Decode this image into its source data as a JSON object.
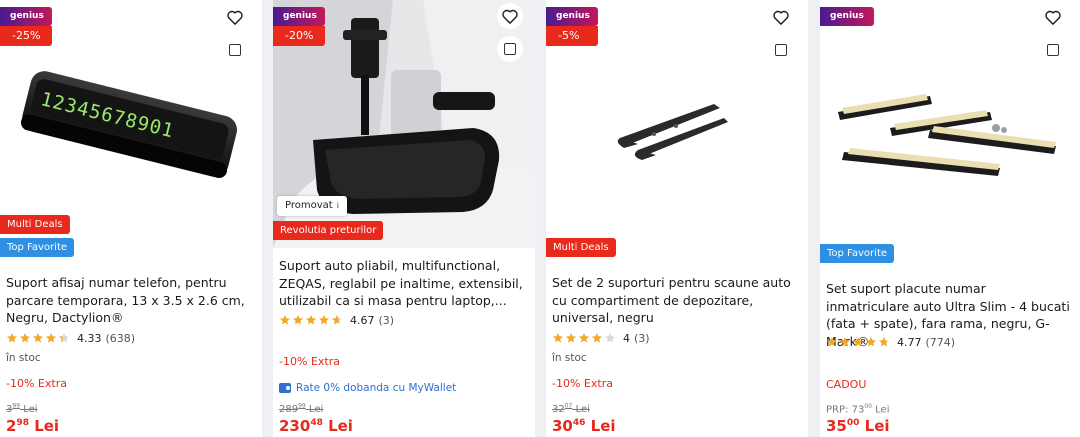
{
  "products": [
    {
      "genius": "genius",
      "discount": "-25%",
      "badges": [
        "Multi Deals",
        "Top Favorite"
      ],
      "title": "Suport afisaj numar telefon, pentru parcare temporara, 13 x 3.5 x 2.6 cm, Negru, Dactylion®",
      "rating": "4.33",
      "reviews": "(638)",
      "stars": 4.33,
      "stock": "în stoc",
      "extra": "-10% Extra",
      "old_price_int": "3",
      "old_price_dec": "99",
      "old_price_cur": "Lei",
      "price_int": "2",
      "price_dec": "98",
      "price_cur": "Lei",
      "image_digits": "12345678901"
    },
    {
      "genius": "genius",
      "discount": "-20%",
      "promovat": "Promovat",
      "promovat_info": "i",
      "badges": [
        "Revolutia preturilor"
      ],
      "title": "Suport auto pliabil, multifunctional, ZEQAS, reglabil pe inaltime, extensibil, utilizabil ca si masa pentru laptop,...",
      "rating": "4.67",
      "reviews": "(3)",
      "stars": 4.67,
      "extra": "-10% Extra",
      "wallet": "Rate 0% dobanda cu MyWallet",
      "old_price_int": "289",
      "old_price_dec": "99",
      "old_price_cur": "Lei",
      "price_int": "230",
      "price_dec": "48",
      "price_cur": "Lei"
    },
    {
      "genius": "genius",
      "discount": "-5%",
      "badges": [
        "Multi Deals"
      ],
      "title": "Set de 2 suporturi pentru scaune auto cu compartiment de depozitare, universal, negru",
      "rating": "4",
      "reviews": "(3)",
      "stars": 4,
      "stock": "în stoc",
      "extra": "-10% Extra",
      "old_price_int": "32",
      "old_price_dec": "07",
      "old_price_cur": "Lei",
      "price_int": "30",
      "price_dec": "46",
      "price_cur": "Lei"
    },
    {
      "genius": "genius",
      "badges": [
        "Top Favorite"
      ],
      "title": "Set suport placute numar inmatriculare auto Ultra Slim - 4 bucati (fata + spate), fara rama, negru, G-Mark®",
      "rating": "4.77",
      "reviews": "(774)",
      "stars": 4.77,
      "cadou": "CADOU",
      "prp_label": "PRP:",
      "old_price_int": "73",
      "old_price_dec": "00",
      "old_price_cur": "Lei",
      "price_int": "35",
      "price_dec": "00",
      "price_cur": "Lei"
    }
  ],
  "colors": {
    "accent_red": "#e8291c",
    "badge_blue": "#2f8fe3",
    "star": "#f5a623",
    "wallet_blue": "#2f6fd0"
  },
  "icons": [
    "heart-icon",
    "compare-checkbox-icon",
    "star-icon",
    "info-icon",
    "wallet-icon"
  ]
}
